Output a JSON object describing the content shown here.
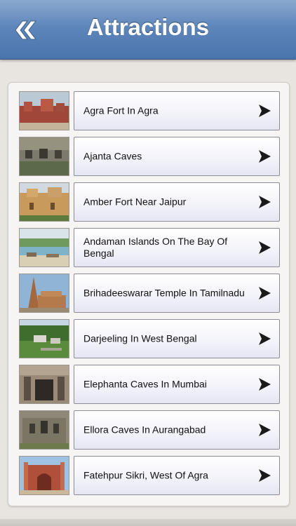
{
  "header": {
    "title": "Attractions",
    "back_icon": "double-chevron-left-icon"
  },
  "colors": {
    "header_top": "#8aa9cf",
    "header_bottom": "#4a74ad",
    "background": "#e8e4e0"
  },
  "attractions": [
    {
      "label": "Agra Fort In Agra"
    },
    {
      "label": "Ajanta Caves"
    },
    {
      "label": "Amber Fort Near Jaipur"
    },
    {
      "label": "Andaman Islands On The Bay Of Bengal"
    },
    {
      "label": "Brihadeeswarar Temple In Tamilnadu"
    },
    {
      "label": "Darjeeling In West Bengal"
    },
    {
      "label": "Elephanta Caves In Mumbai"
    },
    {
      "label": "Ellora Caves In Aurangabad"
    },
    {
      "label": "Fatehpur Sikri, West Of Agra"
    }
  ]
}
